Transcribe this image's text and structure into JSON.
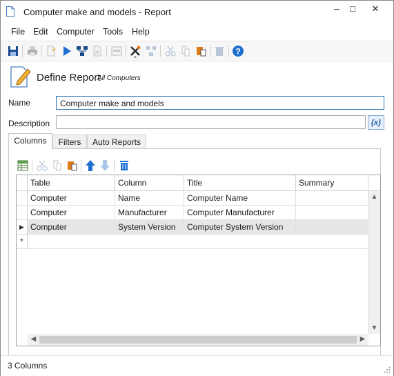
{
  "window": {
    "title": "Computer make and models - Report",
    "minimize": "–",
    "maximize": "□",
    "close": "✕"
  },
  "menu": [
    "File",
    "Edit",
    "Computer",
    "Tools",
    "Help"
  ],
  "toolbar_icons": [
    "save-icon",
    "print-icon",
    "new-doc-icon",
    "run-icon",
    "network-icon",
    "export-icon",
    "csv-icon",
    "tools-icon",
    "connect-icon",
    "cut-icon",
    "copy-icon",
    "paste-icon",
    "delete-icon",
    "help-icon"
  ],
  "header": {
    "title": "Define Report",
    "scope": "All Computers"
  },
  "form": {
    "name_label": "Name",
    "name_value": "Computer make and models",
    "description_label": "Description",
    "description_value": "",
    "fx_label": "{x}"
  },
  "tabs": [
    {
      "label": "Columns",
      "active": true
    },
    {
      "label": "Filters",
      "active": false
    },
    {
      "label": "Auto Reports",
      "active": false
    }
  ],
  "grid": {
    "columns": [
      "Table",
      "Column",
      "Title",
      "Summary"
    ],
    "rows": [
      {
        "table": "Computer",
        "column": "Name",
        "title": "Computer Name",
        "summary": ""
      },
      {
        "table": "Computer",
        "column": "Manufacturer",
        "title": "Computer Manufacturer",
        "summary": ""
      },
      {
        "table": "Computer",
        "column": "System Version",
        "title": "Computer System Version",
        "summary": ""
      }
    ],
    "current_row_marker": "▶",
    "new_row_marker": "*"
  },
  "status": {
    "text": "3 Columns"
  },
  "colors": {
    "accent_blue": "#1f6fd1",
    "dark_blue": "#1a4a8c",
    "orange": "#e07b1a",
    "selected_row": "#e6e6e6"
  }
}
